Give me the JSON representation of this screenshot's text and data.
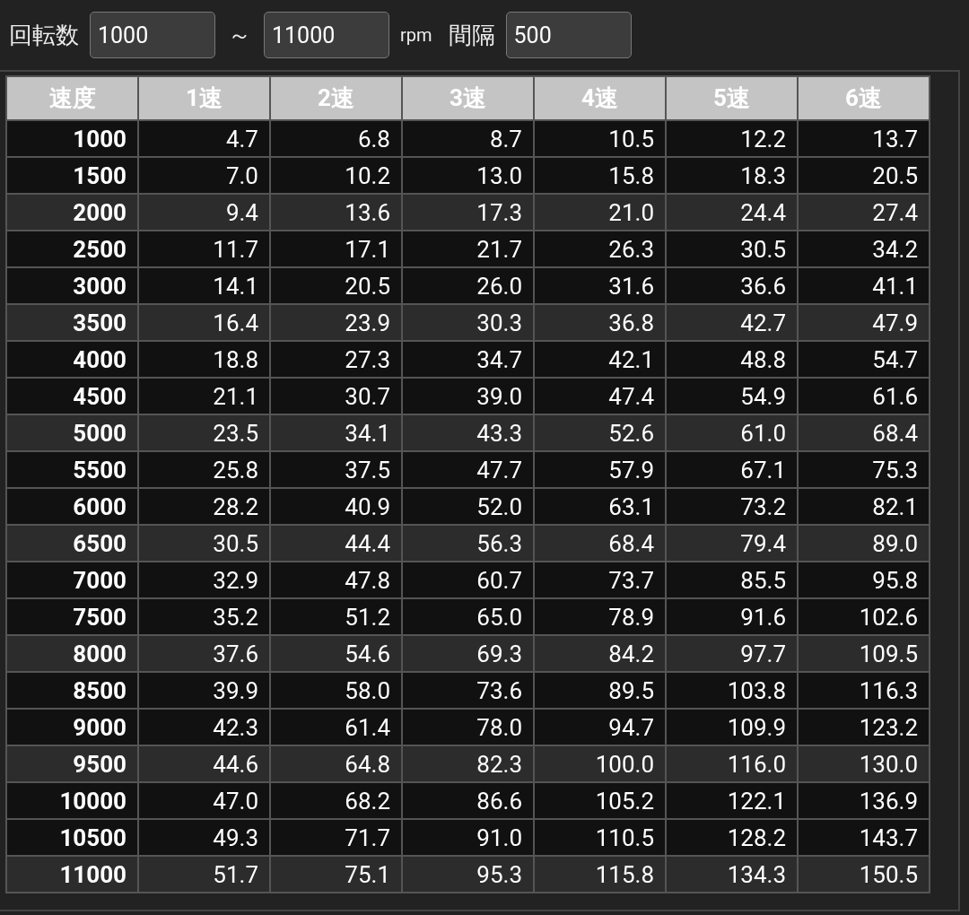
{
  "controls": {
    "rpm_label": "回転数",
    "from": "1000",
    "tilde": "～",
    "to": "11000",
    "unit": "rpm",
    "step_label": "間隔",
    "step": "500"
  },
  "table": {
    "columns": [
      "速度",
      "1速",
      "2速",
      "3速",
      "4速",
      "5速",
      "6速"
    ],
    "rows": [
      {
        "rpm": "1000",
        "values": [
          "4.7",
          "6.8",
          "8.7",
          "10.5",
          "12.2",
          "13.7"
        ]
      },
      {
        "rpm": "1500",
        "values": [
          "7.0",
          "10.2",
          "13.0",
          "15.8",
          "18.3",
          "20.5"
        ]
      },
      {
        "rpm": "2000",
        "values": [
          "9.4",
          "13.6",
          "17.3",
          "21.0",
          "24.4",
          "27.4"
        ]
      },
      {
        "rpm": "2500",
        "values": [
          "11.7",
          "17.1",
          "21.7",
          "26.3",
          "30.5",
          "34.2"
        ]
      },
      {
        "rpm": "3000",
        "values": [
          "14.1",
          "20.5",
          "26.0",
          "31.6",
          "36.6",
          "41.1"
        ]
      },
      {
        "rpm": "3500",
        "values": [
          "16.4",
          "23.9",
          "30.3",
          "36.8",
          "42.7",
          "47.9"
        ]
      },
      {
        "rpm": "4000",
        "values": [
          "18.8",
          "27.3",
          "34.7",
          "42.1",
          "48.8",
          "54.7"
        ]
      },
      {
        "rpm": "4500",
        "values": [
          "21.1",
          "30.7",
          "39.0",
          "47.4",
          "54.9",
          "61.6"
        ]
      },
      {
        "rpm": "5000",
        "values": [
          "23.5",
          "34.1",
          "43.3",
          "52.6",
          "61.0",
          "68.4"
        ]
      },
      {
        "rpm": "5500",
        "values": [
          "25.8",
          "37.5",
          "47.7",
          "57.9",
          "67.1",
          "75.3"
        ]
      },
      {
        "rpm": "6000",
        "values": [
          "28.2",
          "40.9",
          "52.0",
          "63.1",
          "73.2",
          "82.1"
        ]
      },
      {
        "rpm": "6500",
        "values": [
          "30.5",
          "44.4",
          "56.3",
          "68.4",
          "79.4",
          "89.0"
        ]
      },
      {
        "rpm": "7000",
        "values": [
          "32.9",
          "47.8",
          "60.7",
          "73.7",
          "85.5",
          "95.8"
        ]
      },
      {
        "rpm": "7500",
        "values": [
          "35.2",
          "51.2",
          "65.0",
          "78.9",
          "91.6",
          "102.6"
        ]
      },
      {
        "rpm": "8000",
        "values": [
          "37.6",
          "54.6",
          "69.3",
          "84.2",
          "97.7",
          "109.5"
        ]
      },
      {
        "rpm": "8500",
        "values": [
          "39.9",
          "58.0",
          "73.6",
          "89.5",
          "103.8",
          "116.3"
        ]
      },
      {
        "rpm": "9000",
        "values": [
          "42.3",
          "61.4",
          "78.0",
          "94.7",
          "109.9",
          "123.2"
        ]
      },
      {
        "rpm": "9500",
        "values": [
          "44.6",
          "64.8",
          "82.3",
          "100.0",
          "116.0",
          "130.0"
        ]
      },
      {
        "rpm": "10000",
        "values": [
          "47.0",
          "68.2",
          "86.6",
          "105.2",
          "122.1",
          "136.9"
        ]
      },
      {
        "rpm": "10500",
        "values": [
          "49.3",
          "71.7",
          "91.0",
          "110.5",
          "128.2",
          "143.7"
        ]
      },
      {
        "rpm": "11000",
        "values": [
          "51.7",
          "75.1",
          "95.3",
          "115.8",
          "134.3",
          "150.5"
        ]
      }
    ]
  }
}
